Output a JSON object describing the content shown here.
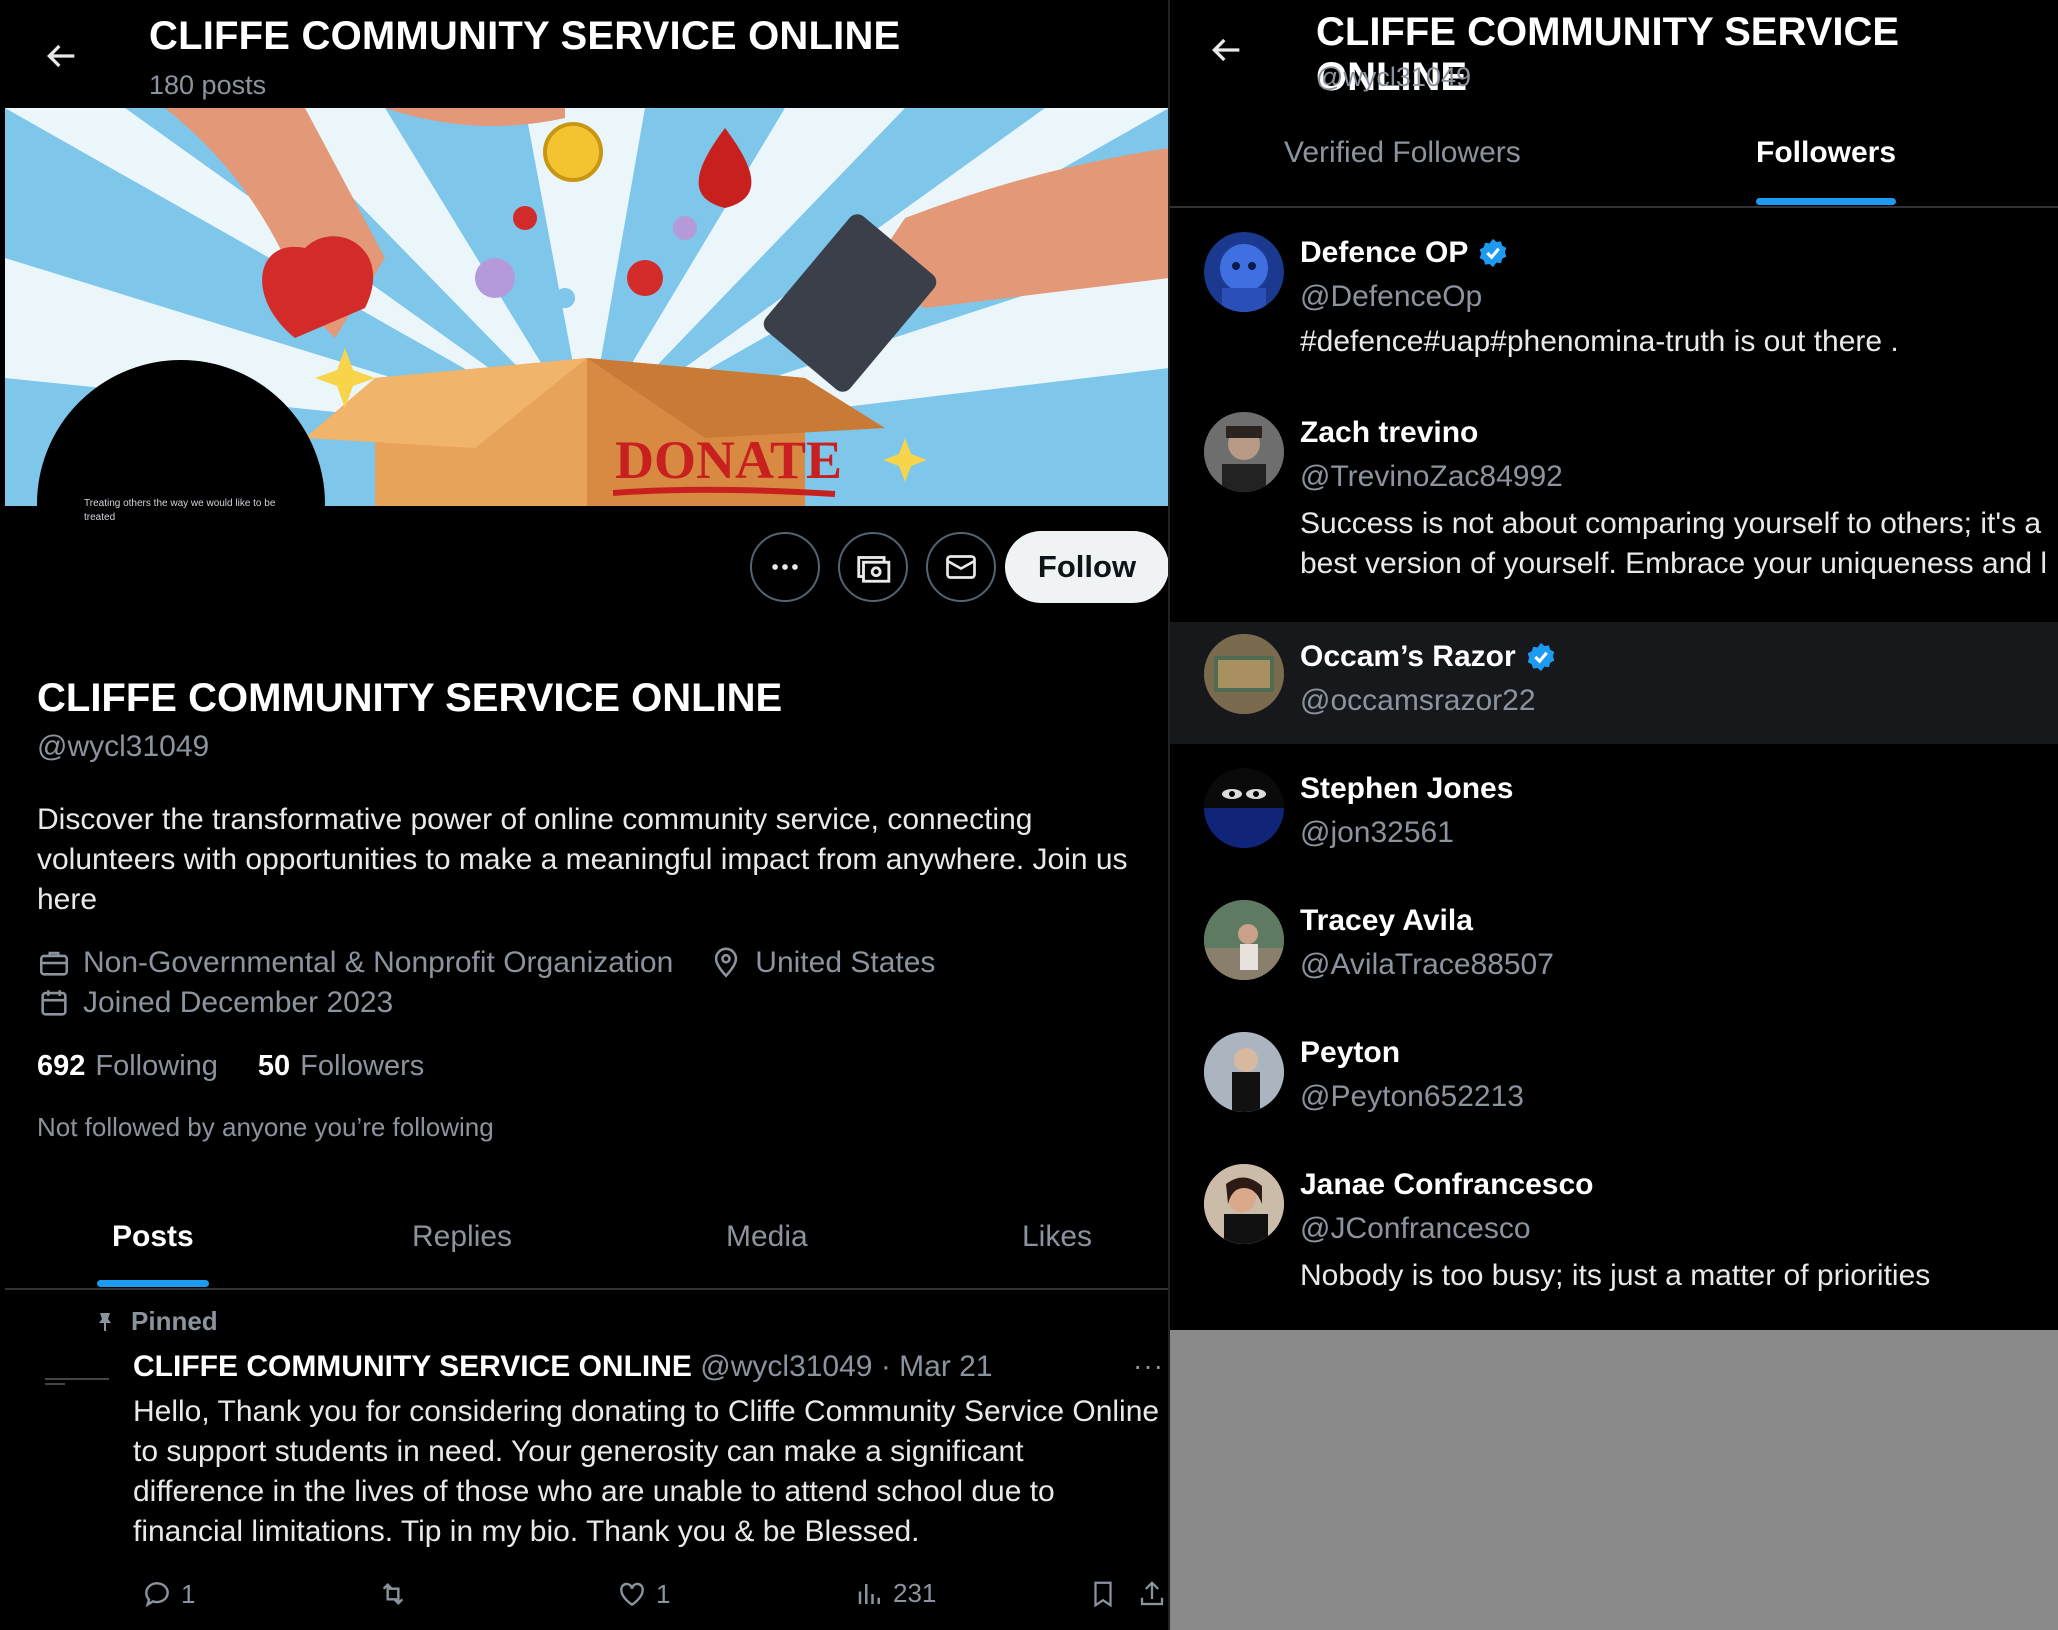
{
  "left": {
    "header": {
      "title": "CLIFFE COMMUNITY SERVICE ONLINE",
      "post_count": "180 posts"
    },
    "banner": {
      "donate_text": "DONATE",
      "avatar_tagline": "Treating others the way we would like to be treated"
    },
    "actions": {
      "follow_label": "Follow",
      "more_icon": "more-icon",
      "subscribe_icon": "money-icon",
      "message_icon": "mail-icon"
    },
    "profile": {
      "name": "CLIFFE COMMUNITY SERVICE ONLINE",
      "handle": "@wycl31049",
      "bio": "Discover the transformative power of online community service, connecting volunteers with opportunities to make a meaningful impact from anywhere. Join us here",
      "category": "Non-Governmental & Nonprofit Organization",
      "location": "United States",
      "joined": "Joined December 2023",
      "following_count": "692",
      "following_label": "Following",
      "followers_count": "50",
      "followers_label": "Followers",
      "not_followed": "Not followed by anyone you’re following"
    },
    "tabs": [
      "Posts",
      "Replies",
      "Media",
      "Likes"
    ],
    "post": {
      "pinned_label": "Pinned",
      "author": "CLIFFE COMMUNITY SERVICE ONLINE",
      "meta": "@wycl31049 · Mar 21",
      "more": "···",
      "text": "Hello, Thank you for considering donating to Cliffe Community Service Online to support students in need. Your generosity can make a significant difference in the lives of those who are unable to attend school due to financial limitations. Tip in my bio. Thank you & be Blessed.",
      "replies": "1",
      "likes": "1",
      "views": "231"
    }
  },
  "right": {
    "header": {
      "title": "CLIFFE COMMUNITY SERVICE ONLINE",
      "handle": "@wycl31049"
    },
    "tabs": {
      "verified": "Verified Followers",
      "followers": "Followers"
    },
    "followers": [
      {
        "name": "Defence OP",
        "handle": "@DefenceOp",
        "verified": true,
        "bio": "#defence#uap#phenomina-truth is out there ."
      },
      {
        "name": "Zach trevino",
        "handle": "@TrevinoZac84992",
        "verified": false,
        "bio": "Success is not about comparing yourself to others; it's a",
        "bio2": "best version of yourself. Embrace your uniqueness and l"
      },
      {
        "name": "Occam’s Razor",
        "handle": "@occamsrazor22",
        "verified": true
      },
      {
        "name": "Stephen Jones",
        "handle": "@jon32561",
        "verified": false
      },
      {
        "name": "Tracey Avila",
        "handle": "@AvilaTrace88507",
        "verified": false
      },
      {
        "name": "Peyton",
        "handle": "@Peyton652213",
        "verified": false
      },
      {
        "name": "Janae Confrancesco",
        "handle": "@JConfrancesco",
        "verified": false,
        "bio": "Nobody is too busy; its just a matter of priorities"
      }
    ]
  },
  "colors": {
    "accent": "#1d9bf0",
    "background": "#000000",
    "muted": "#8b949e",
    "overlay_gray": "#898989"
  }
}
